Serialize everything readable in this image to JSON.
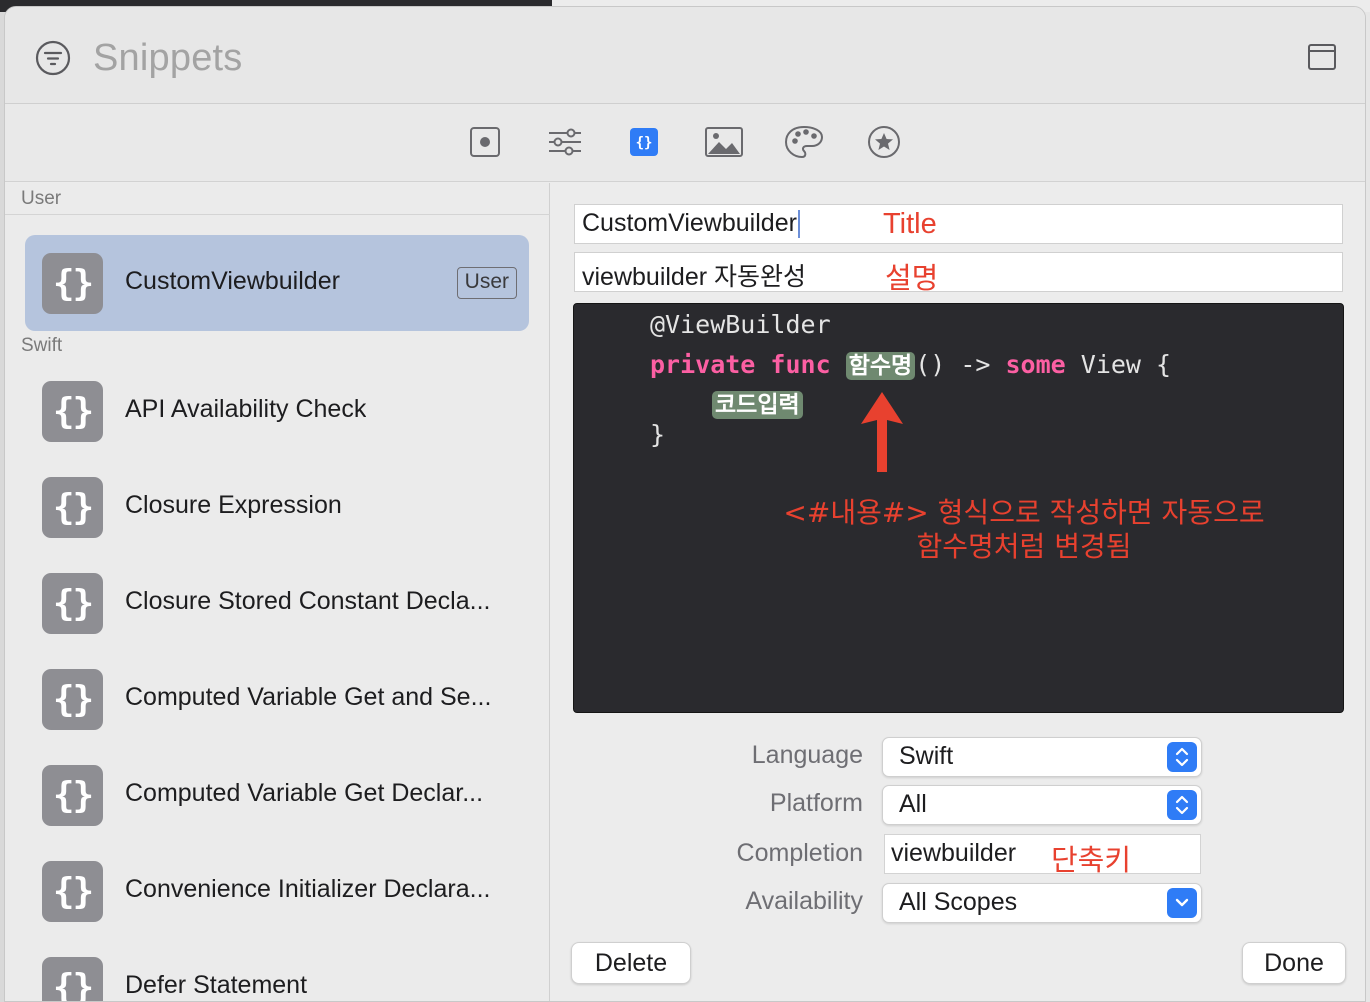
{
  "window": {
    "title": "Snippets"
  },
  "toolbar": {
    "tabs": [
      {
        "icon": "record-icon",
        "selected": false
      },
      {
        "icon": "sliders-icon",
        "selected": false
      },
      {
        "icon": "braces-icon",
        "selected": true
      },
      {
        "icon": "image-icon",
        "selected": false
      },
      {
        "icon": "palette-icon",
        "selected": false
      },
      {
        "icon": "star-icon",
        "selected": false
      }
    ]
  },
  "sidebar": {
    "sections": {
      "user": "User",
      "swift": "Swift"
    },
    "icon_glyph": "{}",
    "items": [
      {
        "label": "CustomViewbuilder",
        "badge": "User",
        "selected": true
      },
      {
        "label": "API Availability Check"
      },
      {
        "label": "Closure Expression"
      },
      {
        "label": "Closure Stored Constant Decla..."
      },
      {
        "label": "Computed Variable Get and Se..."
      },
      {
        "label": "Computed Variable Get Declar..."
      },
      {
        "label": "Convenience Initializer Declara..."
      },
      {
        "label": "Defer Statement"
      }
    ]
  },
  "detail": {
    "title_value": "CustomViewbuilder",
    "title_annotation": "Title",
    "summary_value": "viewbuilder 자동완성",
    "summary_annotation": "설명",
    "code": {
      "line1": "@ViewBuilder",
      "kw_private": "private",
      "kw_func": "func",
      "placeholder_name": "함수명",
      "mid": "() -> ",
      "kw_some": "some",
      "tail": " View {",
      "placeholder_body": "코드입력",
      "close": "}"
    },
    "note_line1": "<#내용#> 형식으로 작성하면 자동으로",
    "note_line2": "함수명처럼 변경됨"
  },
  "form": {
    "language_label": "Language",
    "language_value": "Swift",
    "platform_label": "Platform",
    "platform_value": "All",
    "completion_label": "Completion",
    "completion_value": "viewbuilder",
    "completion_annotation": "단축키",
    "availability_label": "Availability",
    "availability_value": "All Scopes"
  },
  "buttons": {
    "delete": "Delete",
    "done": "Done"
  },
  "colors": {
    "accent": "#2f7cf6",
    "selection": "#b5c4dd",
    "annotation": "#e8412f",
    "editor_bg": "#2a2a2e",
    "keyword": "#fc5fa3",
    "placeholder": "#6f8970"
  }
}
